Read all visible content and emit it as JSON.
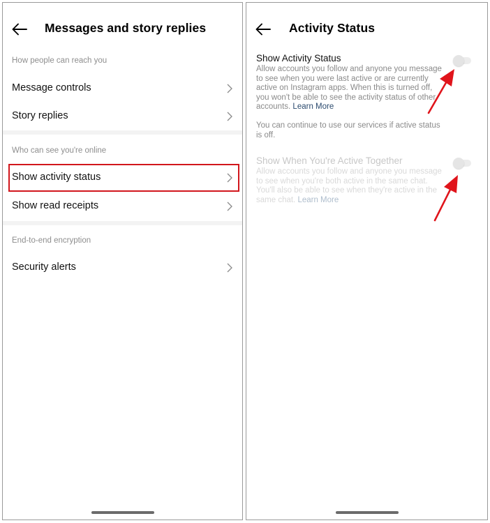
{
  "left_screen": {
    "header": {
      "back_icon": "arrow-left-icon",
      "title": "Messages and story replies"
    },
    "sections": [
      {
        "label": "How people can reach you",
        "items": [
          {
            "label": "Message controls",
            "icon": "chevron-right-icon"
          },
          {
            "label": "Story replies",
            "icon": "chevron-right-icon"
          }
        ]
      },
      {
        "label": "Who can see you're online",
        "items": [
          {
            "label": "Show activity status",
            "icon": "chevron-right-icon",
            "highlighted": true
          },
          {
            "label": "Show read receipts",
            "icon": "chevron-right-icon"
          }
        ]
      },
      {
        "label": "End-to-end encryption",
        "items": [
          {
            "label": "Security alerts",
            "icon": "chevron-right-icon"
          }
        ]
      }
    ]
  },
  "right_screen": {
    "header": {
      "back_icon": "arrow-left-icon",
      "title": "Activity Status"
    },
    "settings": [
      {
        "title": "Show Activity Status",
        "description": "Allow accounts you follow and anyone you message to see when you were last active or are currently active on Instagram apps. When this is turned off, you won't be able to see the activity status of other accounts.",
        "link": "Learn More",
        "enabled": true,
        "toggle_on": false
      },
      {
        "title": "Show When You're Active Together",
        "description": "Allow accounts you follow and anyone you message to see when you're both active in the same chat. You'll also be able to see when they're active in the same chat.",
        "link": "Learn More",
        "enabled": false,
        "toggle_on": false
      }
    ],
    "note": "You can continue to use our services if active status is off."
  },
  "annotations": {
    "highlight_color": "#d2161c",
    "arrow_color": "#e0141b",
    "highlight_target": "Show activity status",
    "arrow_targets": [
      "Show Activity Status toggle",
      "Show When You're Active Together toggle"
    ]
  }
}
